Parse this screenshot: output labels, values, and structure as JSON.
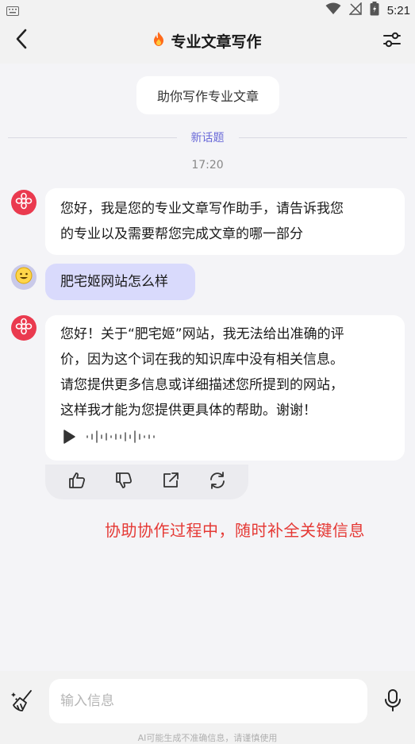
{
  "status_bar": {
    "time": "5:21",
    "icons": [
      "keyboard-icon",
      "wifi-icon",
      "no-signal-icon",
      "battery-icon"
    ]
  },
  "header": {
    "title": "专业文章写作",
    "title_icon": "fire-icon",
    "back_icon": "chevron-left-icon",
    "settings_icon": "sliders-icon"
  },
  "topic_chip": {
    "label": "助你写作专业文章"
  },
  "divider": {
    "label": "新话题"
  },
  "timestamp": "17:20",
  "messages": [
    {
      "role": "bot",
      "text_lines": [
        "您好，我是您的专业文章写作助手，请告诉我您",
        "的专业以及需要帮您完成文章的哪一部分"
      ]
    },
    {
      "role": "user",
      "text_lines": [
        "肥宅姬网站怎么样"
      ]
    },
    {
      "role": "bot",
      "text_lines": [
        "您好！关于“肥宅姬”网站，我无法给出准确的评",
        "价，因为这个词在我的知识库中没有相关信息。",
        "请您提供更多信息或详细描述您所提到的网站，",
        "这样我才能为您提供更具体的帮助。谢谢！"
      ]
    }
  ],
  "actions": [
    {
      "name": "thumbs-up-icon"
    },
    {
      "name": "thumbs-down-icon"
    },
    {
      "name": "share-icon"
    },
    {
      "name": "regenerate-icon"
    }
  ],
  "note": "协助协作过程中，随时补全关键信息",
  "input": {
    "placeholder": "输入信息"
  },
  "disclaimer": "AI可能生成不准确信息，请谨慎使用",
  "colors": {
    "accent": "#6a6ad8",
    "bot_avatar": "#ea3a4f",
    "user_bubble": "#d9dafc",
    "note": "#e53935"
  }
}
